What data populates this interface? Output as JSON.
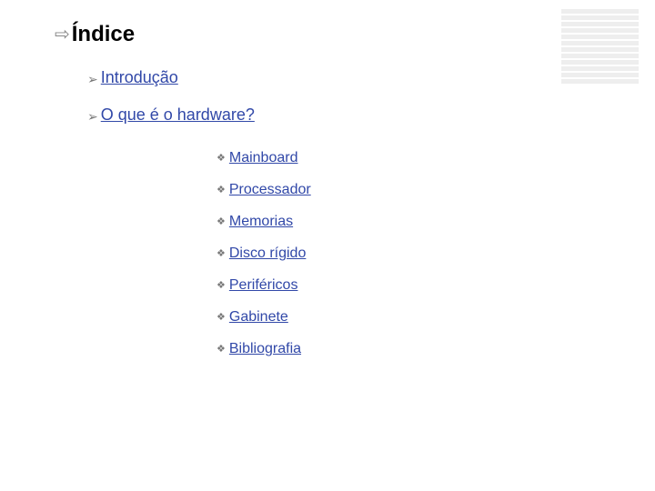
{
  "title": "Índice",
  "level1": {
    "intro": "Introdução",
    "hardware": "O que é o hardware?"
  },
  "level2": {
    "mainboard": "Mainboard",
    "processador": "Processador",
    "memorias": "Memorias",
    "disco": "Disco rígido",
    "perifericos": "Periféricos",
    "gabinete": "Gabinete",
    "bibliografia": "Bibliografia"
  },
  "bullets": {
    "arrow": "⇨",
    "chevron": "➢",
    "diamond": "❖"
  }
}
